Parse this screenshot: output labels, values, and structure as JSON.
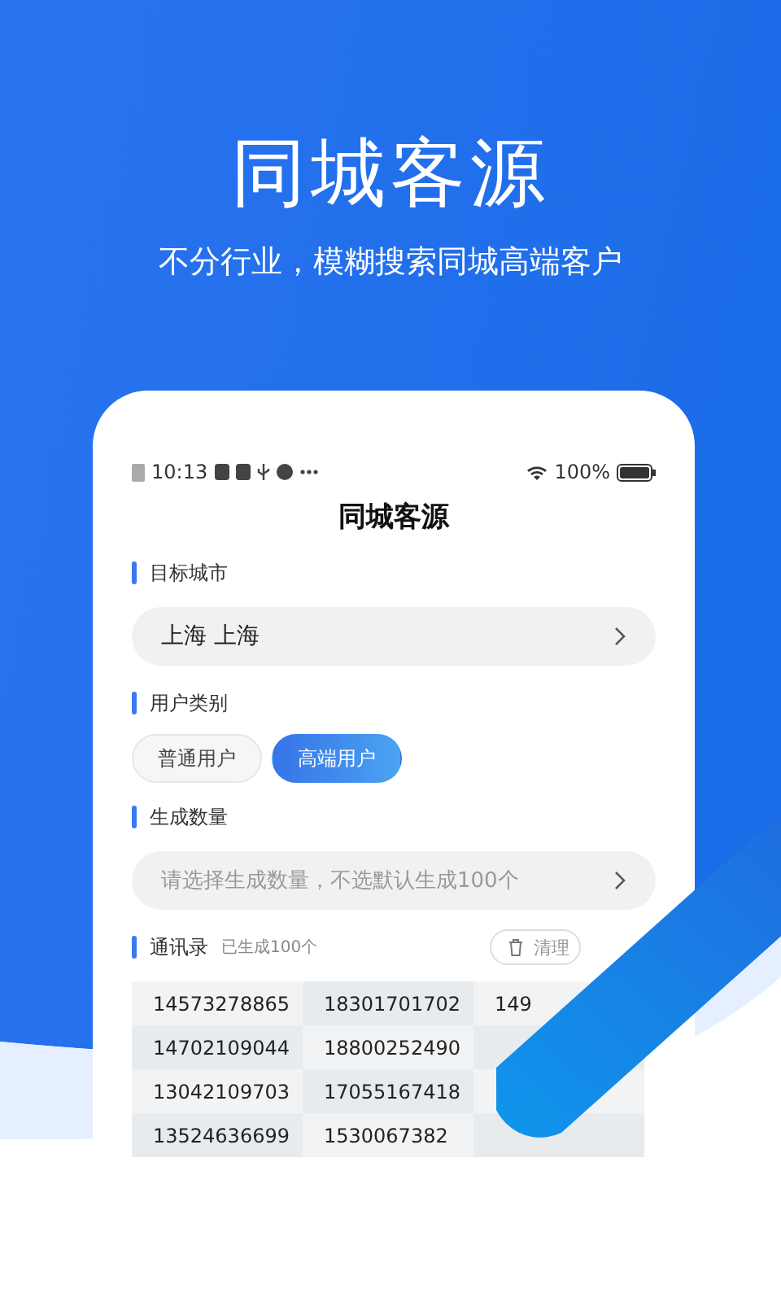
{
  "hero": {
    "title": "同城客源",
    "subtitle": "不分行业，模糊搜索同城高端客户"
  },
  "phone": {
    "status_bar": {
      "time": "10:13",
      "battery": "100%"
    },
    "title": "同城客源",
    "sections": [
      {
        "kind": "select",
        "label": "目标城市",
        "value": "上海 上海"
      },
      {
        "kind": "chips",
        "label": "用户类别",
        "options": [
          {
            "label": "普通用户",
            "selected": false
          },
          {
            "label": "高端用户",
            "selected": true
          }
        ]
      },
      {
        "kind": "select",
        "label": "生成数量",
        "placeholder": "请选择生成数量，不选默认生成100个"
      },
      {
        "kind": "table",
        "label": "通讯录",
        "note": "已生成100个",
        "action": "清理",
        "rows": [
          [
            "14573278865",
            "18301701702",
            "149"
          ],
          [
            "14702109044",
            "18800252490"
          ],
          [
            "13042109703",
            "17055167418"
          ],
          [
            "13524636699",
            "1530067382"
          ]
        ]
      }
    ]
  }
}
